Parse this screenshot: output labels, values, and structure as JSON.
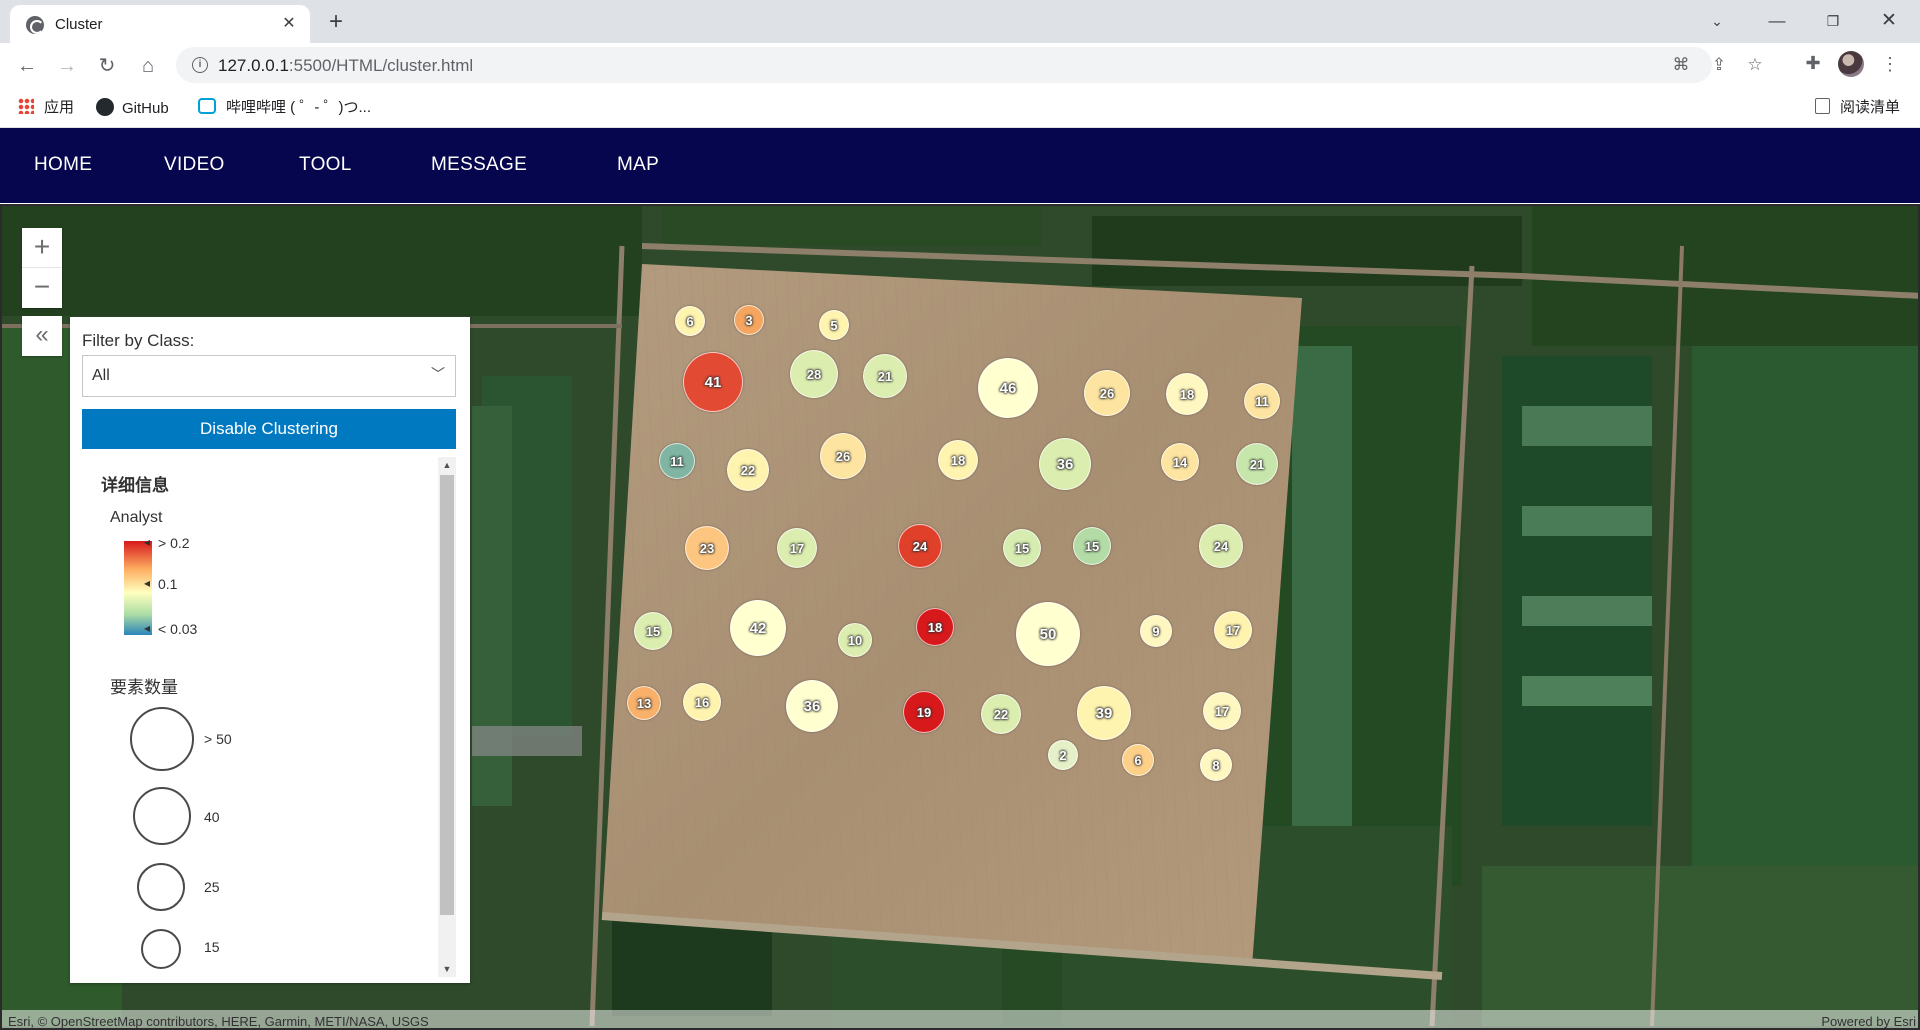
{
  "browser": {
    "tab_title": "Cluster",
    "url_host": "127.0.0.1",
    "url_rest": ":5500/HTML/cluster.html",
    "bookmarks": {
      "apps": "应用",
      "github": "GitHub",
      "bilibili": "哔哩哔哩 ( ゜- ゜)つ...",
      "reading_list": "阅读清单"
    }
  },
  "nav": {
    "items": [
      "HOME",
      "VIDEO",
      "TOOL",
      "MESSAGE",
      "MAP"
    ]
  },
  "panel": {
    "filter_label": "Filter by Class:",
    "filter_value": "All",
    "cluster_button": "Disable Clustering",
    "legend_title": "详细信息",
    "analyst_label": "Analyst",
    "ramp_labels": [
      "> 0.2",
      "0.1",
      "< 0.03"
    ],
    "count_label": "要素数量",
    "size_labels": [
      "> 50",
      "40",
      "25",
      "15"
    ]
  },
  "attribution": {
    "left": "Esri, © OpenStreetMap contributors, HERE, Garmin, METI/NASA, USGS",
    "right": "Powered by Esri"
  },
  "colors": {
    "nav_bg": "#06064f",
    "button_blue": "#0079c1",
    "cluster_red": "#d7191c",
    "cluster_orange": "#fdae61",
    "cluster_yellow": "#ffffbf",
    "cluster_green": "#abdda4",
    "cluster_teal": "#66a5a0"
  },
  "clusters": [
    {
      "label": "6",
      "color": "#fff3b0"
    },
    {
      "label": "3",
      "color": "#f4a660"
    },
    {
      "label": "5",
      "color": "#fff3b0"
    },
    {
      "label": "41",
      "color": "#e34a33"
    },
    {
      "label": "28",
      "color": "#dcedb0"
    },
    {
      "label": "21",
      "color": "#dcedb0"
    },
    {
      "label": "46",
      "color": "#ffffd0"
    },
    {
      "label": "26",
      "color": "#fde4a0"
    },
    {
      "label": "18",
      "color": "#fff7c0"
    },
    {
      "label": "11",
      "color": "#fde4a0"
    },
    {
      "label": "11",
      "color": "#7fb5a2"
    },
    {
      "label": "22",
      "color": "#fff3b0"
    },
    {
      "label": "26",
      "color": "#fde4a0"
    },
    {
      "label": "18",
      "color": "#fff3b0"
    },
    {
      "label": "36",
      "color": "#dcedb0"
    },
    {
      "label": "14",
      "color": "#fde4a0"
    },
    {
      "label": "21",
      "color": "#c7e6ab"
    },
    {
      "label": "23",
      "color": "#fdc680"
    },
    {
      "label": "17",
      "color": "#dcedb0"
    },
    {
      "label": "24",
      "color": "#e0402a"
    },
    {
      "label": "15",
      "color": "#d6ecb0"
    },
    {
      "label": "15",
      "color": "#b3dba6"
    },
    {
      "label": "24",
      "color": "#dcedb0"
    },
    {
      "label": "15",
      "color": "#dcedb0"
    },
    {
      "label": "42",
      "color": "#ffffd0"
    },
    {
      "label": "10",
      "color": "#dcedb0"
    },
    {
      "label": "18",
      "color": "#d7191c"
    },
    {
      "label": "50",
      "color": "#ffffd0"
    },
    {
      "label": "9",
      "color": "#fff7c0"
    },
    {
      "label": "17",
      "color": "#fff3b0"
    },
    {
      "label": "13",
      "color": "#f8b06a"
    },
    {
      "label": "16",
      "color": "#fff3b0"
    },
    {
      "label": "36",
      "color": "#ffffd0"
    },
    {
      "label": "19",
      "color": "#d7191c"
    },
    {
      "label": "22",
      "color": "#dcedb0"
    },
    {
      "label": "39",
      "color": "#fff3b0"
    },
    {
      "label": "17",
      "color": "#fff7c0"
    },
    {
      "label": "2",
      "color": "#e6f0c8"
    },
    {
      "label": "6",
      "color": "#fdd08a"
    },
    {
      "label": "8",
      "color": "#fff7c0"
    }
  ]
}
